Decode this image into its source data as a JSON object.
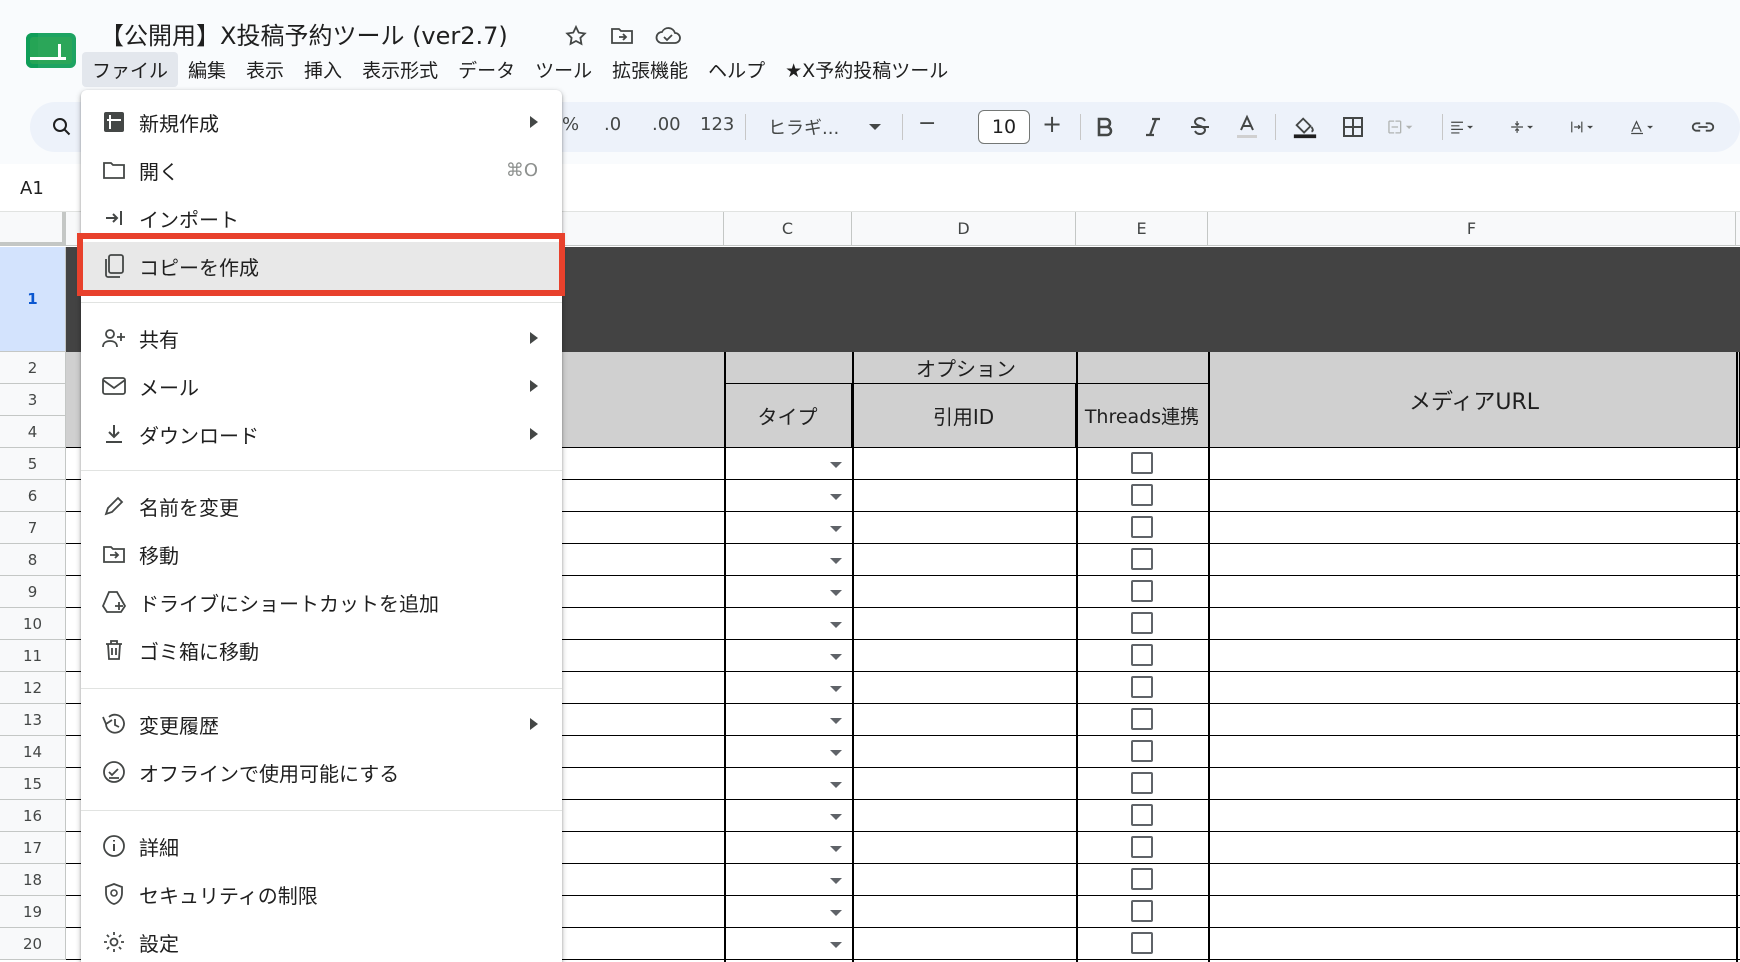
{
  "document": {
    "title": "【公開用】X投稿予約ツール (ver2.7)"
  },
  "menubar": [
    "ファイル",
    "編集",
    "表示",
    "挿入",
    "表示形式",
    "データ",
    "ツール",
    "拡張機能",
    "ヘルプ",
    "★X予約投稿ツール"
  ],
  "toolbar": {
    "percent": "%",
    "decrease_decimal": ".0",
    "increase_decimal": ".00",
    "number_format": "123",
    "font": "ヒラギ...",
    "font_size": "10",
    "minus": "−",
    "plus": "+"
  },
  "name_box": "A1",
  "columns": [
    "C",
    "D",
    "E",
    "F"
  ],
  "rows": [
    "1",
    "2",
    "3",
    "4",
    "5",
    "6",
    "7",
    "8",
    "9",
    "10",
    "11",
    "12",
    "13",
    "14",
    "15",
    "16",
    "17",
    "18",
    "19",
    "20"
  ],
  "table_headers": {
    "options": "オプション",
    "type": "タイプ",
    "quote_id": "引用ID",
    "threads": "Threads連携",
    "media_url": "メディアURL"
  },
  "file_menu": {
    "new": "新規作成",
    "open": "開く",
    "open_shortcut": "⌘O",
    "import": "インポート",
    "make_copy": "コピーを作成",
    "share": "共有",
    "email": "メール",
    "download": "ダウンロード",
    "rename": "名前を変更",
    "move": "移動",
    "add_shortcut": "ドライブにショートカットを追加",
    "trash": "ゴミ箱に移動",
    "version_history": "変更履歴",
    "offline": "オフラインで使用可能にする",
    "details": "詳細",
    "security": "セキュリティの制限",
    "settings": "設定"
  },
  "colors": {
    "highlight": "#e8412c",
    "header_bg": "#d0d0d0",
    "dark_band": "#434343"
  }
}
